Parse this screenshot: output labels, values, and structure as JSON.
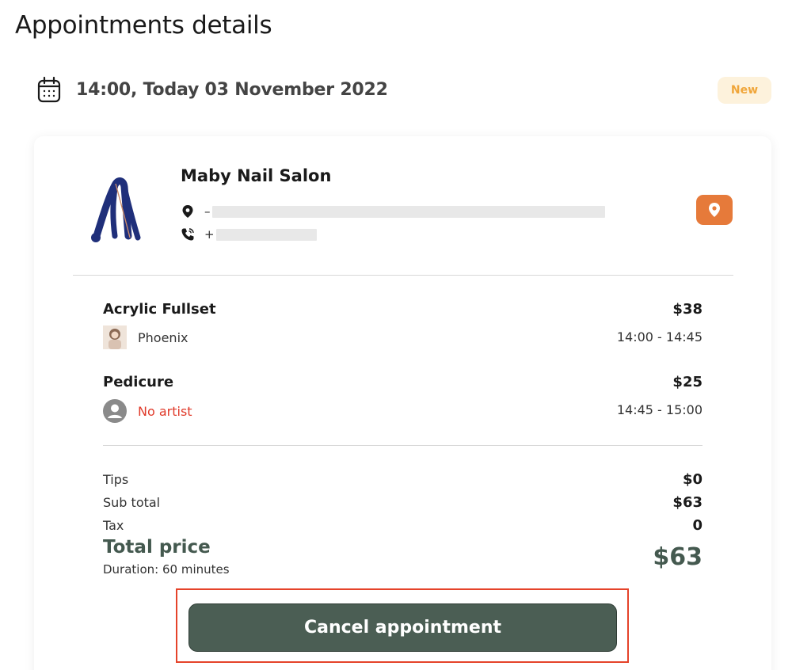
{
  "page": {
    "title": "Appointments details"
  },
  "appointment": {
    "datetime": "14:00, Today 03 November 2022",
    "status": "New"
  },
  "salon": {
    "name": "Maby Nail Salon",
    "address_prefix": "–",
    "phone_prefix": "+",
    "address_redacted": true,
    "phone_redacted": true
  },
  "services": [
    {
      "name": "Acrylic Fullset",
      "price": "$38",
      "artist": "Phoenix",
      "time": "14:00 - 14:45"
    },
    {
      "name": "Pedicure",
      "price": "$25",
      "artist": "No artist",
      "time": "14:45 - 15:00"
    }
  ],
  "summary": {
    "tips_label": "Tips",
    "tips": "$0",
    "subtotal_label": "Sub total",
    "subtotal": "$63",
    "tax_label": "Tax",
    "tax": "0",
    "total_label": "Total price",
    "total": "$63",
    "duration": "Duration: 60 minutes"
  },
  "actions": {
    "cancel_label": "Cancel appointment"
  },
  "icons": {
    "calendar": "calendar-icon",
    "location": "location-pin-icon",
    "phone": "phone-icon",
    "map": "map-pin-icon",
    "avatar_placeholder": "user-avatar-icon"
  },
  "colors": {
    "accent_green": "#44594f",
    "button_green": "#4b5e54",
    "pin_orange": "#e67a3a",
    "badge_bg": "#fdf2dc",
    "badge_text": "#f0a63a",
    "no_artist_red": "#e03a2a",
    "highlight_red": "#e5432a"
  }
}
